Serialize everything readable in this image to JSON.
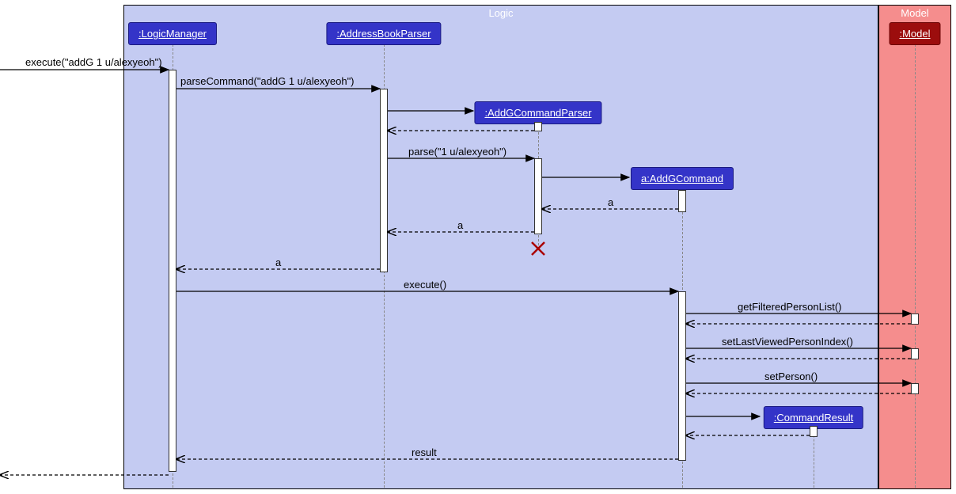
{
  "frames": {
    "logic": "Logic",
    "model": "Model"
  },
  "participants": {
    "lm": ":LogicManager",
    "abp": ":AddressBookParser",
    "agcp": ":AddGCommandParser",
    "agc": "a:AddGCommand",
    "cr": ":CommandResult",
    "model": ":Model"
  },
  "messages": {
    "m1": "execute(\"addG 1 u/alexyeoh\")",
    "m2": "parseCommand(\"addG 1 u/alexyeoh\")",
    "m3": "parse(\"1 u/alexyeoh\")",
    "m4": "a",
    "m5": "a",
    "m6": "a",
    "m7": "execute()",
    "m8": "getFilteredPersonList()",
    "m9": "setLastViewedPersonIndex()",
    "m10": "setPerson()",
    "m11": "result"
  },
  "chart_data": {
    "type": "uml-sequence-diagram",
    "frames": [
      {
        "name": "Logic",
        "participants": [
          "LogicManager",
          "AddressBookParser",
          "AddGCommandParser",
          "AddGCommand",
          "CommandResult"
        ]
      },
      {
        "name": "Model",
        "participants": [
          "Model"
        ]
      }
    ],
    "participants": [
      {
        "id": "lm",
        "name": ":LogicManager",
        "created_at_start": true
      },
      {
        "id": "abp",
        "name": ":AddressBookParser",
        "created_at_start": true
      },
      {
        "id": "agcp",
        "name": ":AddGCommandParser",
        "created_by": "abp",
        "destroyed": true
      },
      {
        "id": "agc",
        "name": "a:AddGCommand",
        "created_by": "agcp"
      },
      {
        "id": "cr",
        "name": ":CommandResult",
        "created_by": "agc"
      },
      {
        "id": "model",
        "name": ":Model",
        "created_at_start": true
      }
    ],
    "messages": [
      {
        "from": null,
        "to": "lm",
        "label": "execute(\"addG 1 u/alexyeoh\")",
        "type": "sync"
      },
      {
        "from": "lm",
        "to": "abp",
        "label": "parseCommand(\"addG 1 u/alexyeoh\")",
        "type": "sync"
      },
      {
        "from": "abp",
        "to": "agcp",
        "label": "",
        "type": "create"
      },
      {
        "from": "agcp",
        "to": "abp",
        "label": "",
        "type": "return"
      },
      {
        "from": "abp",
        "to": "agcp",
        "label": "parse(\"1 u/alexyeoh\")",
        "type": "sync"
      },
      {
        "from": "agcp",
        "to": "agc",
        "label": "",
        "type": "create"
      },
      {
        "from": "agc",
        "to": "agcp",
        "label": "a",
        "type": "return"
      },
      {
        "from": "agcp",
        "to": "abp",
        "label": "a",
        "type": "return"
      },
      {
        "from": "agcp",
        "to": null,
        "label": "",
        "type": "destroy"
      },
      {
        "from": "abp",
        "to": "lm",
        "label": "a",
        "type": "return"
      },
      {
        "from": "lm",
        "to": "agc",
        "label": "execute()",
        "type": "sync"
      },
      {
        "from": "agc",
        "to": "model",
        "label": "getFilteredPersonList()",
        "type": "sync"
      },
      {
        "from": "model",
        "to": "agc",
        "label": "",
        "type": "return"
      },
      {
        "from": "agc",
        "to": "model",
        "label": "setLastViewedPersonIndex()",
        "type": "sync"
      },
      {
        "from": "model",
        "to": "agc",
        "label": "",
        "type": "return"
      },
      {
        "from": "agc",
        "to": "model",
        "label": "setPerson()",
        "type": "sync"
      },
      {
        "from": "model",
        "to": "agc",
        "label": "",
        "type": "return"
      },
      {
        "from": "agc",
        "to": "cr",
        "label": "",
        "type": "create"
      },
      {
        "from": "cr",
        "to": "agc",
        "label": "",
        "type": "return"
      },
      {
        "from": "agc",
        "to": "lm",
        "label": "result",
        "type": "return"
      },
      {
        "from": "lm",
        "to": null,
        "label": "",
        "type": "return"
      }
    ]
  }
}
